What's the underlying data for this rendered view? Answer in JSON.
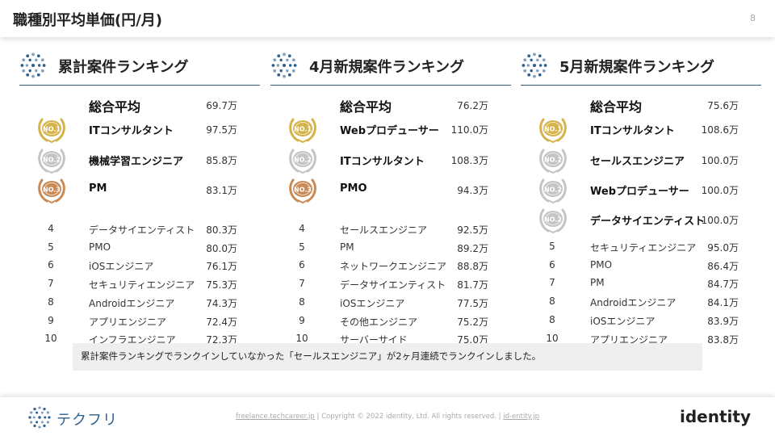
{
  "header": {
    "title": "職種別平均単価(円/月)",
    "page_number": "8"
  },
  "colors": {
    "accent": "#2d5f8f",
    "gold": "#d6b24a",
    "silver": "#c4c4c4",
    "bronze": "#c98a55"
  },
  "columns": [
    {
      "title": "累計案件ランキング",
      "average": {
        "label": "総合平均",
        "value": "69.7万"
      },
      "rows": [
        {
          "rank": "1",
          "name": "ITコンサルタント",
          "value": "97.5万",
          "medal": "gold"
        },
        {
          "rank": "2",
          "name": "機械学習エンジニア",
          "value": "85.8万",
          "medal": "silver"
        },
        {
          "rank": "3",
          "name": "PM",
          "value": "83.1万",
          "medal": "bronze"
        },
        {
          "rank": "4",
          "name": "データサイエンティスト",
          "value": "80.3万"
        },
        {
          "rank": "5",
          "name": "PMO",
          "value": "80.0万"
        },
        {
          "rank": "6",
          "name": "iOSエンジニア",
          "value": "76.1万"
        },
        {
          "rank": "7",
          "name": "セキュリティエンジニア",
          "value": "75.3万"
        },
        {
          "rank": "8",
          "name": "Androidエンジニア",
          "value": "74.3万"
        },
        {
          "rank": "9",
          "name": "アプリエンジニア",
          "value": "72.4万"
        },
        {
          "rank": "10",
          "name": "インフラエンジニア",
          "value": "72.3万"
        }
      ]
    },
    {
      "title": "4月新規案件ランキング",
      "average": {
        "label": "総合平均",
        "value": "76.2万"
      },
      "rows": [
        {
          "rank": "1",
          "name": "Webプロデューサー",
          "value": "110.0万",
          "medal": "gold"
        },
        {
          "rank": "2",
          "name": "ITコンサルタント",
          "value": "108.3万",
          "medal": "silver"
        },
        {
          "rank": "3",
          "name": "PMO",
          "value": "94.3万",
          "medal": "bronze"
        },
        {
          "rank": "4",
          "name": "セールスエンジニア",
          "value": "92.5万"
        },
        {
          "rank": "5",
          "name": "PM",
          "value": "89.2万"
        },
        {
          "rank": "6",
          "name": "ネットワークエンジニア",
          "value": "88.8万"
        },
        {
          "rank": "7",
          "name": "データサイエンティスト",
          "value": "81.7万"
        },
        {
          "rank": "8",
          "name": "iOSエンジニア",
          "value": "77.5万"
        },
        {
          "rank": "9",
          "name": "その他エンジニア",
          "value": "75.2万"
        },
        {
          "rank": "10",
          "name": "サーバーサイド",
          "value": "75.0万"
        }
      ]
    },
    {
      "title": "5月新規案件ランキング",
      "average": {
        "label": "総合平均",
        "value": "75.6万"
      },
      "rows": [
        {
          "rank": "1",
          "name": "ITコンサルタント",
          "value": "108.6万",
          "medal": "gold"
        },
        {
          "rank": "2",
          "name": "セールスエンジニア",
          "value": "100.0万",
          "medal": "silver"
        },
        {
          "rank": "2",
          "name": "Webプロデューサー",
          "value": "100.0万",
          "medal": "silver"
        },
        {
          "rank": "2",
          "name": "データサイエンティスト",
          "value": "100.0万",
          "medal": "silver"
        },
        {
          "rank": "5",
          "name": "セキュリティエンジニア",
          "value": "95.0万"
        },
        {
          "rank": "6",
          "name": "PMO",
          "value": "86.4万"
        },
        {
          "rank": "7",
          "name": "PM",
          "value": "84.7万"
        },
        {
          "rank": "8",
          "name": "Androidエンジニア",
          "value": "84.1万"
        },
        {
          "rank": "8",
          "name": "iOSエンジニア",
          "value": "83.9万"
        },
        {
          "rank": "10",
          "name": "アプリエンジニア",
          "value": "83.8万"
        }
      ]
    }
  ],
  "note": "累計案件ランキングでランクインしていなかった「セールスエンジニア」が2ヶ月連続でランクインしました。",
  "footer": {
    "brand": "テクフリ",
    "link1": "freelance.techcareer.jp",
    "copyright": "| Copyright © 2022 identity, Ltd. All rights reserved. |",
    "link2": "id-entity.jp",
    "company": "identity"
  }
}
